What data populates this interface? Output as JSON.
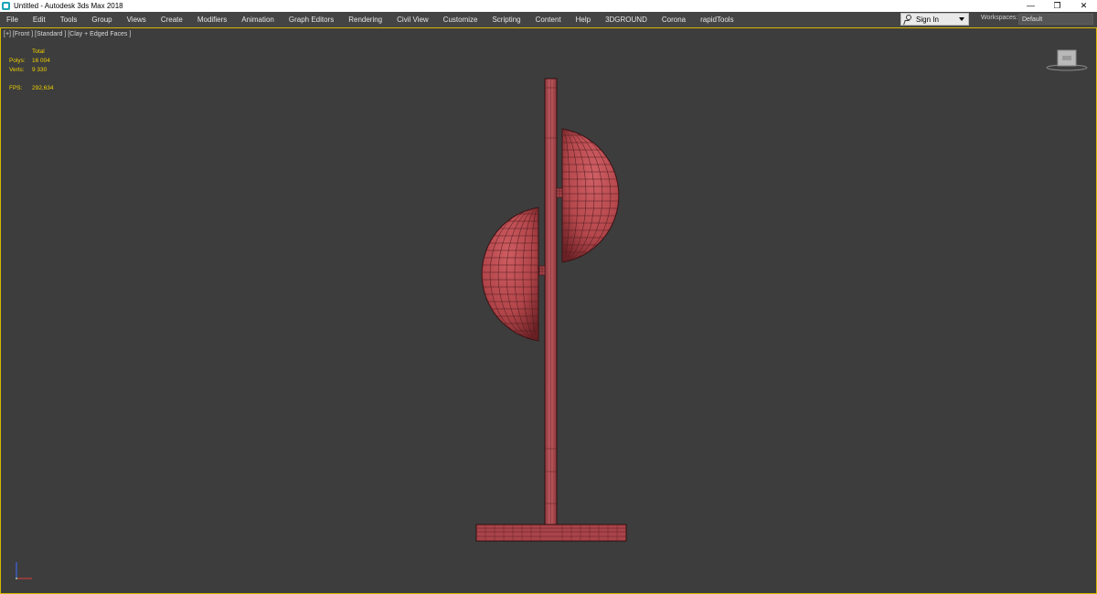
{
  "window": {
    "title": "Untitled - Autodesk 3ds Max 2018",
    "controls": {
      "minimize": "—",
      "restore": "❐",
      "close": "✕"
    }
  },
  "menu": [
    "File",
    "Edit",
    "Tools",
    "Group",
    "Views",
    "Create",
    "Modifiers",
    "Animation",
    "Graph Editors",
    "Rendering",
    "Civil View",
    "Customize",
    "Scripting",
    "Content",
    "Help",
    "3DGROUND",
    "Corona",
    "rapidTools"
  ],
  "signin": {
    "label": "Sign In"
  },
  "workspaces": {
    "label": "Workspaces:",
    "value": "Default"
  },
  "viewport": {
    "label": "[+] [Front ] [Standard ] [Clay + Edged Faces ]",
    "stats": {
      "header": "Total",
      "polys_label": "Polys:",
      "polys_value": "16 004",
      "verts_label": "Verts:",
      "verts_value": "9 330",
      "fps_label": "FPS:",
      "fps_value": "292,634"
    }
  },
  "colors": {
    "viewport_bg": "#3d3d3d",
    "model": "#b5484d",
    "stat_text": "#f0d000",
    "active_border": "#d4b800"
  }
}
